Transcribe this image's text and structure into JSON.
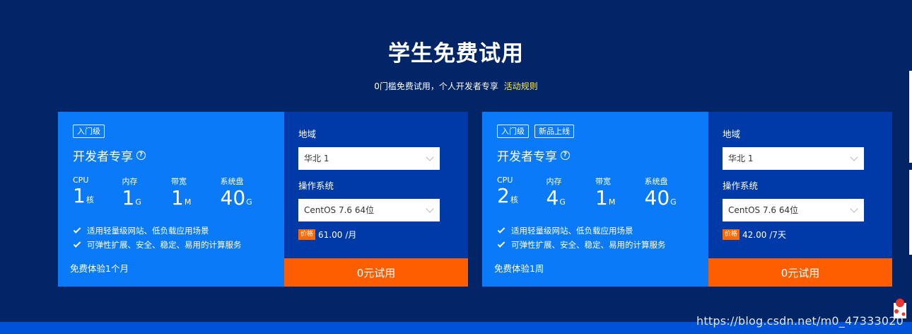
{
  "header": {
    "title": "学生免费试用",
    "subtitle": "0门槛免费试用，个人开发者专享",
    "rules_link": "活动规则"
  },
  "cards": [
    {
      "tags": [
        "入门级"
      ],
      "plan_title": "开发者专享",
      "specs": [
        {
          "label": "CPU",
          "value": "1",
          "unit": "核"
        },
        {
          "label": "内存",
          "value": "1",
          "unit": "G"
        },
        {
          "label": "带宽",
          "value": "1",
          "unit": "M"
        },
        {
          "label": "系统盘",
          "value": "40",
          "unit": "G"
        }
      ],
      "features": [
        "适用轻量级网站、低负载应用场景",
        "可弹性扩展、安全、稳定、易用的计算服务"
      ],
      "trial_period": "免费体验1个月",
      "region_label": "地域",
      "region_value": "华北 1",
      "os_label": "操作系统",
      "os_value": "CentOS 7.6 64位",
      "price_badge": "价格",
      "price": "61.00",
      "price_unit": "/月",
      "button_label": "0元试用"
    },
    {
      "tags": [
        "入门级",
        "新品上线"
      ],
      "plan_title": "开发者专享",
      "specs": [
        {
          "label": "CPU",
          "value": "2",
          "unit": "核"
        },
        {
          "label": "内存",
          "value": "4",
          "unit": "G"
        },
        {
          "label": "带宽",
          "value": "1",
          "unit": "M"
        },
        {
          "label": "系统盘",
          "value": "40",
          "unit": "G"
        }
      ],
      "features": [
        "适用轻量级网站、低负载应用场景",
        "可弹性扩展、安全、稳定、易用的计算服务"
      ],
      "trial_period": "免费体验1周",
      "region_label": "地域",
      "region_value": "华北 1",
      "os_label": "操作系统",
      "os_value": "CentOS 7.6 64位",
      "price_badge": "价格",
      "price": "42.00",
      "price_unit": "/7天",
      "button_label": "0元试用"
    }
  ],
  "watermark": "https://blog.csdn.net/m0_47333020",
  "colors": {
    "background": "#022567",
    "card_left": "#0a7af8",
    "card_right": "#0039a8",
    "button": "#ff5e00",
    "link": "#ffee44"
  }
}
